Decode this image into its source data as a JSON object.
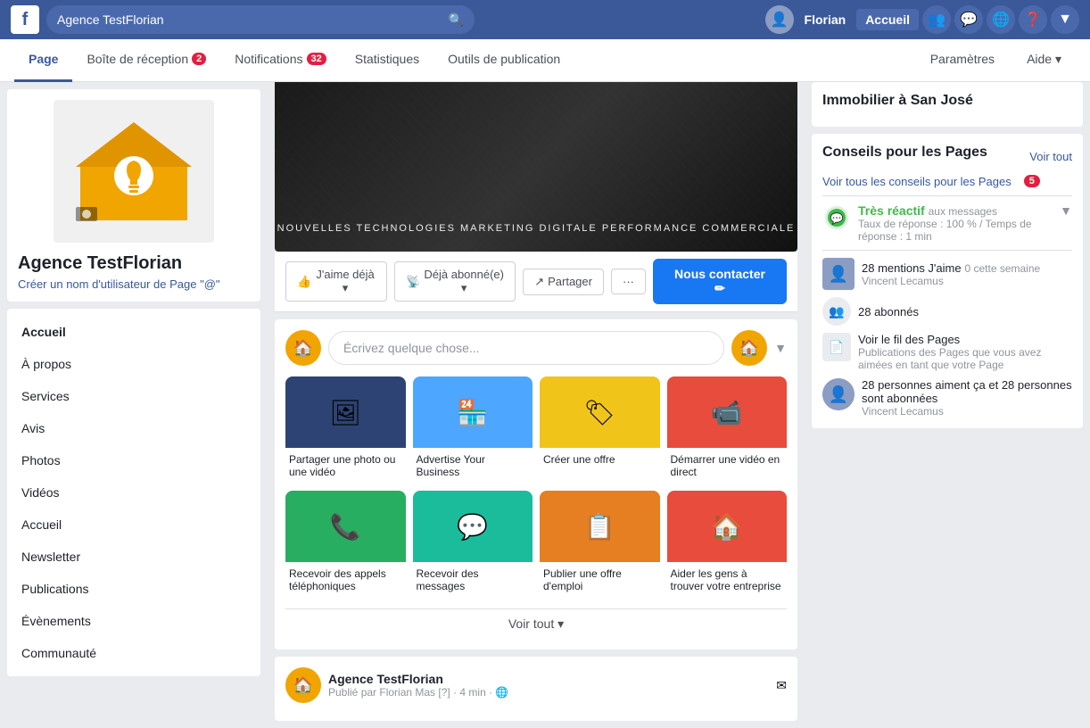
{
  "topnav": {
    "logo": "f",
    "search_placeholder": "Agence TestFlorian",
    "search_value": "Agence TestFlorian",
    "user_name": "Florian",
    "accueil_label": "Accueil",
    "chevron_label": "▼"
  },
  "pagenav": {
    "tabs": [
      {
        "label": "Page",
        "active": true,
        "badge": null
      },
      {
        "label": "Boîte de réception",
        "active": false,
        "badge": "2"
      },
      {
        "label": "Notifications",
        "active": false,
        "badge": "32"
      },
      {
        "label": "Statistiques",
        "active": false,
        "badge": null
      },
      {
        "label": "Outils de publication",
        "active": false,
        "badge": null
      }
    ],
    "right_links": [
      {
        "label": "Paramètres"
      },
      {
        "label": "Aide ▾"
      }
    ]
  },
  "sidebar": {
    "page_name": "Agence TestFlorian",
    "username_hint": "Créer un nom d'utilisateur de Page \"@\"",
    "nav_items": [
      {
        "label": "Accueil",
        "active": true
      },
      {
        "label": "À propos",
        "active": false
      },
      {
        "label": "Services",
        "active": false
      },
      {
        "label": "Avis",
        "active": false
      },
      {
        "label": "Photos",
        "active": false
      },
      {
        "label": "Vidéos",
        "active": false
      },
      {
        "label": "Accueil",
        "active": false
      },
      {
        "label": "Newsletter",
        "active": false
      },
      {
        "label": "Publications",
        "active": false
      },
      {
        "label": "Évènements",
        "active": false
      },
      {
        "label": "Communauté",
        "active": false
      }
    ]
  },
  "cover": {
    "text": "NOUVELLES TECHNOLOGIES   MARKETING DIGITALE   PERFORMANCE COMMERCIALE"
  },
  "action_bar": {
    "buttons": [
      {
        "icon": "👍",
        "label": "J'aime déjà ▾"
      },
      {
        "icon": "📡",
        "label": "Déjà abonné(e) ▾"
      },
      {
        "icon": "↗",
        "label": "Partager"
      },
      {
        "icon": "···",
        "label": ""
      }
    ],
    "contact_btn": "Nous contacter ✏"
  },
  "post_create": {
    "placeholder": "Écrivez quelque chose..."
  },
  "action_cards": [
    {
      "icon": "🖼",
      "label": "Partager une photo ou une vidéo",
      "color": "#2d4373"
    },
    {
      "icon": "🏪",
      "label": "Advertise Your Business",
      "color": "#4da6ff"
    },
    {
      "icon": "🏷",
      "label": "Créer une offre",
      "color": "#f0c419"
    },
    {
      "icon": "📹",
      "label": "Démarrer une vidéo en direct",
      "color": "#e74c3c"
    },
    {
      "icon": "📞",
      "label": "Recevoir des appels téléphoniques",
      "color": "#27ae60"
    },
    {
      "icon": "💬",
      "label": "Recevoir des messages",
      "color": "#1abc9c"
    },
    {
      "icon": "📋",
      "label": "Publier une offre d'emploi",
      "color": "#e67e22"
    },
    {
      "icon": "🏠",
      "label": "Aider les gens à trouver votre entreprise",
      "color": "#e74c3c"
    }
  ],
  "voir_tout_label": "Voir tout ▾",
  "post": {
    "page_name": "Agence TestFlorian",
    "meta": "Publié par Florian Mas [?] · 4 min · 🌐"
  },
  "right_sidebar": {
    "immobilier_title": "Immobilier à San José",
    "conseils_title": "Conseils pour les Pages",
    "conseils_voir_tout": "Voir tout",
    "voir_tous_conseils": "Voir tous les conseils pour les Pages",
    "conseils_badge": "5",
    "reactif_label": "Très réactif",
    "reactif_sub": "aux messages",
    "taux_label": "Taux de réponse : 100 % / Temps de réponse : 1 min",
    "mentions_count": "28 mentions J'aime",
    "mentions_sub": "0 cette semaine",
    "mentions_user": "Vincent Lecamus",
    "abonnes_count": "28 abonnés",
    "voir_fil_label": "Voir le fil des Pages",
    "voir_fil_sub": "Publications des Pages que vous avez aimées en tant que votre Page",
    "personnes_label": "28 personnes aiment ça et 28 personnes sont abonnées",
    "personnes_user": "Vincent Lecamus"
  }
}
